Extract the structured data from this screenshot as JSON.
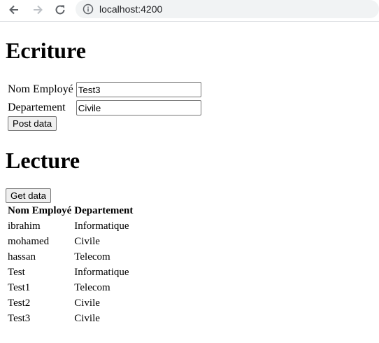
{
  "browser": {
    "url": "localhost:4200",
    "icons": [
      "back-arrow-icon",
      "forward-arrow-icon",
      "reload-icon",
      "info-icon"
    ]
  },
  "ecriture": {
    "title": "Ecriture",
    "fields": [
      {
        "label": "Nom Employé",
        "value": "Test3"
      },
      {
        "label": "Departement",
        "value": "Civile"
      }
    ],
    "post_button": "Post data"
  },
  "lecture": {
    "title": "Lecture",
    "get_button": "Get data",
    "columns": [
      "Nom Employé",
      "Departement"
    ],
    "rows": [
      [
        "ibrahim",
        "Informatique"
      ],
      [
        "mohamed",
        "Civile"
      ],
      [
        "hassan",
        "Telecom"
      ],
      [
        "Test",
        "Informatique"
      ],
      [
        "Test1",
        "Telecom"
      ],
      [
        "Test2",
        "Civile"
      ],
      [
        "Test3",
        "Civile"
      ]
    ]
  }
}
